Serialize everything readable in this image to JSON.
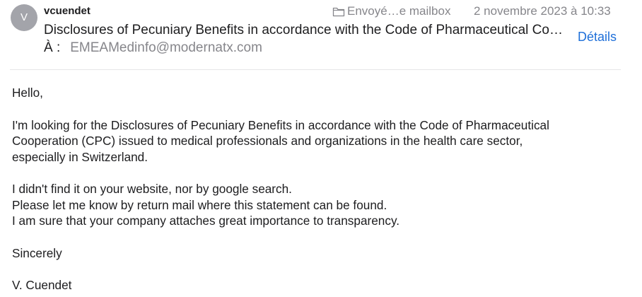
{
  "header": {
    "avatar_letter": "V",
    "sender": "vcuendet",
    "mailbox": "Envoyé…e mailbox",
    "mailbox_icon": "folder-icon",
    "date": "2 novembre 2023 à 10:33",
    "subject": "Disclosures of Pecuniary Benefits in accordance with the Code of Pharmaceutical Cooperation (CPC)",
    "details_label": "Détails",
    "to_label": "À :",
    "to_address": "EMEAMedinfo@modernatx.com"
  },
  "body": {
    "greeting": "Hello,",
    "paragraph1": [
      "I'm looking for the Disclosures of Pecuniary Benefits in accordance with the Code of Pharmaceutical",
      "Cooperation (CPC) issued to medical professionals and organizations in the health care sector,",
      "especially in Switzerland."
    ],
    "paragraph2": [
      "I didn't find it on your website, nor by google search.",
      "Please let me know by return mail where this statement can be found.",
      "I am sure that your company attaches great importance to transparency."
    ],
    "closing": "Sincerely",
    "signature": "V. Cuendet"
  },
  "colors": {
    "accent_link": "#1e6fd9",
    "secondary_text": "#86868b",
    "avatar_bg": "#a3a4aa"
  }
}
